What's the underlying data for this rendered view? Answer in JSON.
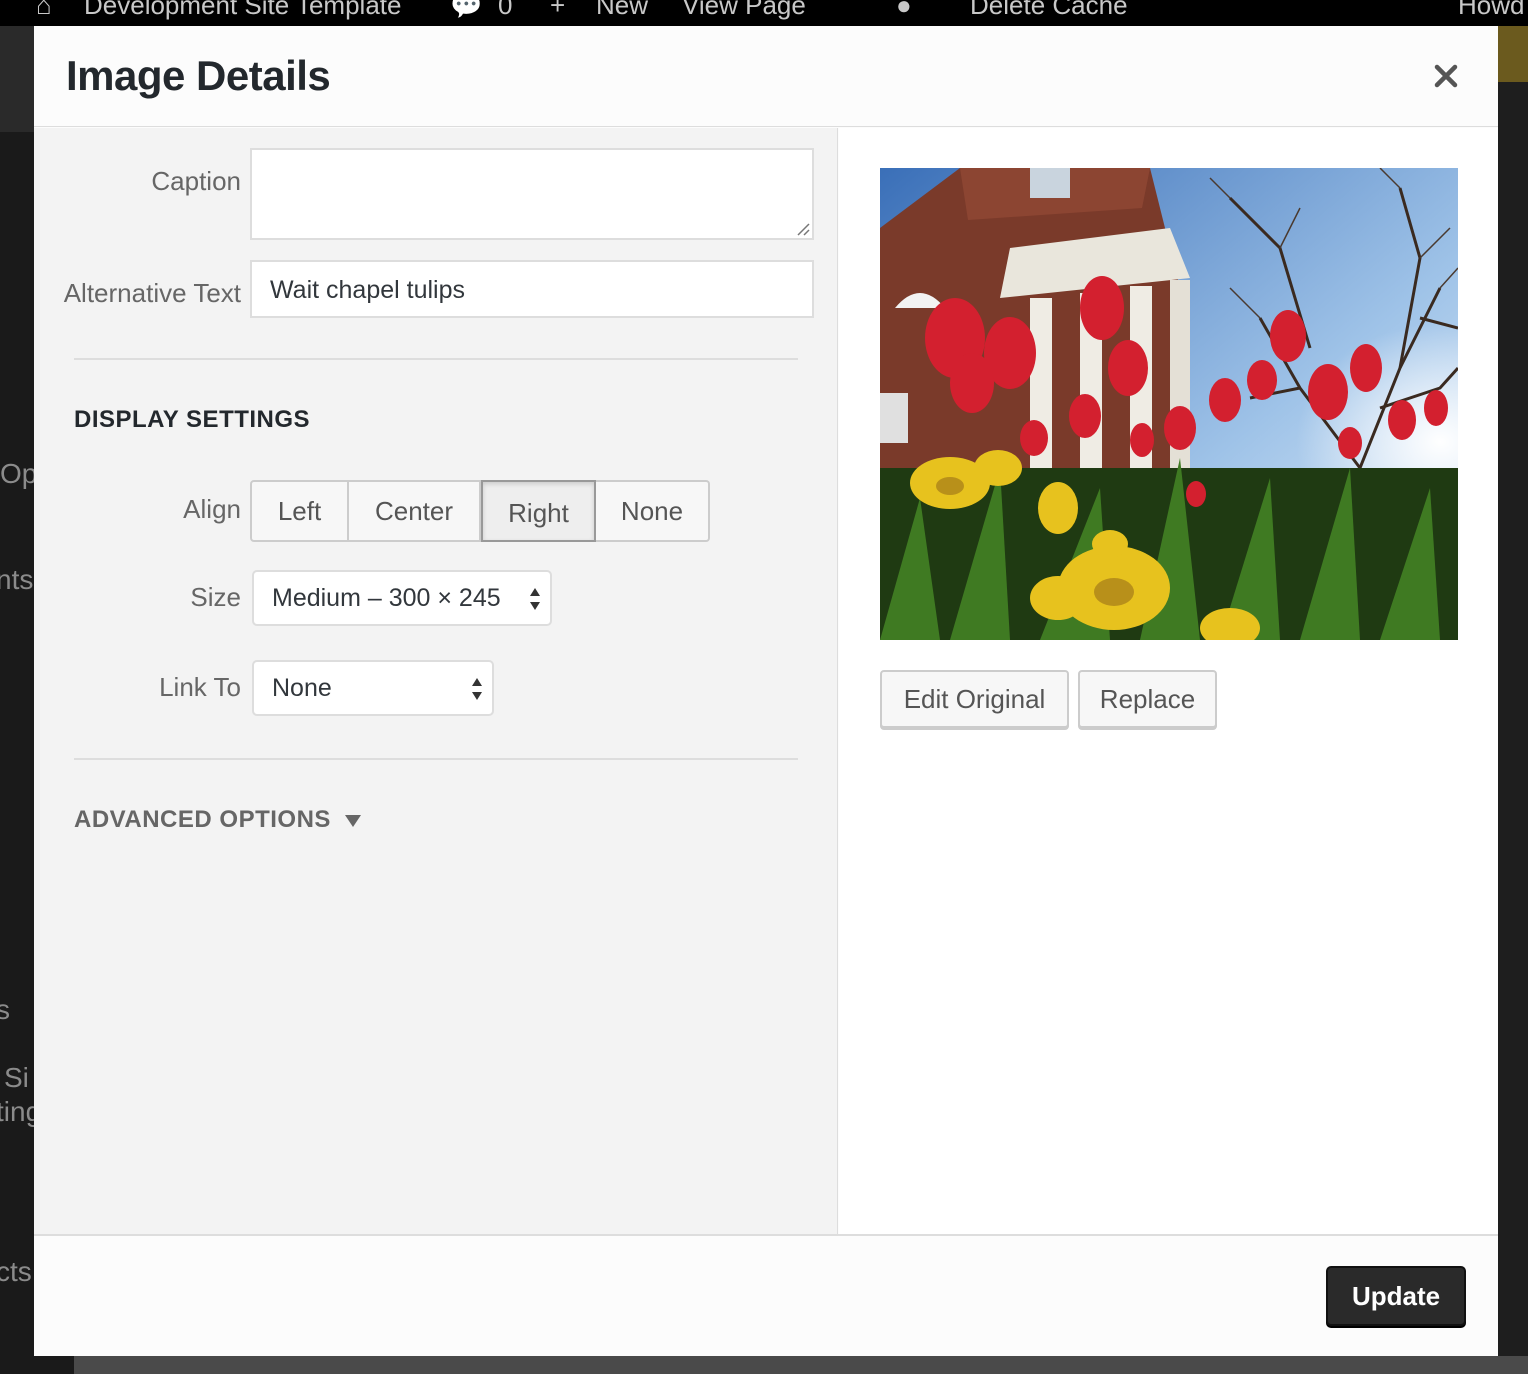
{
  "adminbar": {
    "site_name": "Development Site Template",
    "comments_count": "0",
    "new_label": "New",
    "view_page_label": "View Page",
    "delete_cache_label": "Delete Cache",
    "howdy_label": "Howd"
  },
  "background_menu": {
    "fragments": [
      "Op",
      "nts",
      "s",
      "Si",
      "ting",
      "cts"
    ]
  },
  "modal": {
    "title": "Image Details",
    "close_icon": "close-icon"
  },
  "details": {
    "caption_label": "Caption",
    "caption_value": "",
    "alt_label": "Alternative Text",
    "alt_value": "Wait chapel tulips"
  },
  "display_settings": {
    "title": "DISPLAY SETTINGS",
    "align_label": "Align",
    "align_options": [
      "Left",
      "Center",
      "Right",
      "None"
    ],
    "align_selected": "Right",
    "size_label": "Size",
    "size_value": "Medium – 300 × 245",
    "link_label": "Link To",
    "link_value": "None"
  },
  "advanced": {
    "title": "ADVANCED OPTIONS"
  },
  "preview": {
    "edit_original_label": "Edit Original",
    "replace_label": "Replace"
  },
  "footer": {
    "update_label": "Update"
  },
  "colors": {
    "modal_bg": "#fcfcfc",
    "pane_bg": "#f3f3f3",
    "primary_button": "#2a2a2a",
    "text": "#23282d",
    "muted_text": "#666666"
  }
}
